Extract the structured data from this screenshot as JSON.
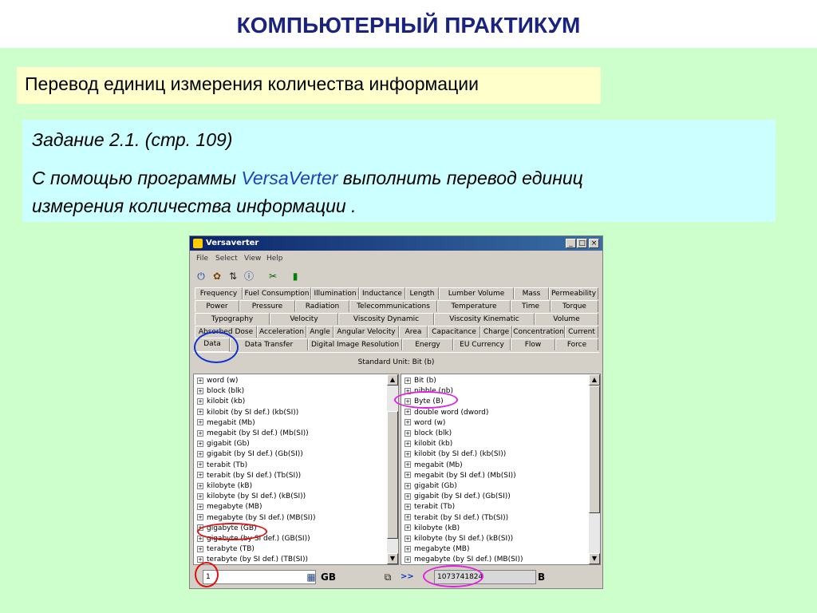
{
  "header": {
    "title": "КОМПЬЮТЕРНЫЙ ПРАКТИКУМ"
  },
  "subtitle": "Перевод единиц измерения количества информации",
  "task": {
    "line1": "Задание 2.1. (стр. 109)",
    "line2_prefix": "С помощью программы ",
    "line2_program": "VersaVerter",
    "line2_suffix": " выполнить перевод единиц",
    "line3": "измерения количества информации ."
  },
  "window": {
    "title": "Versaverter",
    "controls": {
      "minimize": "_",
      "maximize": "□",
      "close": "×"
    },
    "menu": [
      "File",
      "Select",
      "View",
      "Help"
    ],
    "tabs_row1": [
      "Frequency",
      "Fuel Consumption",
      "Illumination",
      "Inductance",
      "Length",
      "Lumber Volume",
      "Mass",
      "Permeability"
    ],
    "tabs_row2": [
      "Power",
      "Pressure",
      "Radiation",
      "Telecommunications",
      "Temperature",
      "Time",
      "Torque"
    ],
    "tabs_row3": [
      "Typography",
      "Velocity",
      "Viscosity Dynamic",
      "Viscosity Kinematic",
      "Volume"
    ],
    "tabs_row4": [
      "Absorbed Dose",
      "Acceleration",
      "Angle",
      "Angular Velocity",
      "Area",
      "Capacitance",
      "Charge",
      "Concentration",
      "Current"
    ],
    "tabs_row5": [
      "Data",
      "Data Transfer",
      "Digital Image Resolution",
      "Energy",
      "EU Currency",
      "Flow",
      "Force"
    ],
    "standard_unit": "Standard Unit: Bit (b)",
    "left_list": [
      "word (w)",
      "block (blk)",
      "kilobit (kb)",
      "kilobit (by SI def.) (kb(SI))",
      "megabit (Mb)",
      "megabit (by SI def.) (Mb(SI))",
      "gigabit (Gb)",
      "gigabit (by SI def.) (Gb(SI))",
      "terabit (Tb)",
      "terabit (by SI def.) (Tb(SI))",
      "kilobyte (kB)",
      "kilobyte (by SI def.) (kB(SI))",
      "megabyte (MB)",
      "megabyte (by SI def.) (MB(SI))",
      "gigabyte (GB)",
      "gigabyte (by SI def.) (GB(SI))",
      "terabyte (TB)",
      "terabyte (by SI def.) (TB(SI))"
    ],
    "right_list": [
      "Bit (b)",
      "nibble (nb)",
      "Byte (B)",
      "double word (dword)",
      "word (w)",
      "block (blk)",
      "kilobit (kb)",
      "kilobit (by SI def.) (kb(SI))",
      "megabit (Mb)",
      "megabit (by SI def.) (Mb(SI))",
      "gigabit (Gb)",
      "gigabit (by SI def.) (Gb(SI))",
      "terabit (Tb)",
      "terabit (by SI def.) (Tb(SI))",
      "kilobyte (kB)",
      "kilobyte (by SI def.) (kB(SI))",
      "megabyte (MB)",
      "megabyte (by SI def.) (MB(SI))"
    ],
    "input_value": "1",
    "input_unit": "GB",
    "convert_label": ">>",
    "output_value": "1073741824",
    "output_unit": "B"
  },
  "colors": {
    "title": "#1a237e",
    "highlight_blue": "#1030d0",
    "highlight_red": "#e01010",
    "highlight_magenta": "#e020e0"
  }
}
